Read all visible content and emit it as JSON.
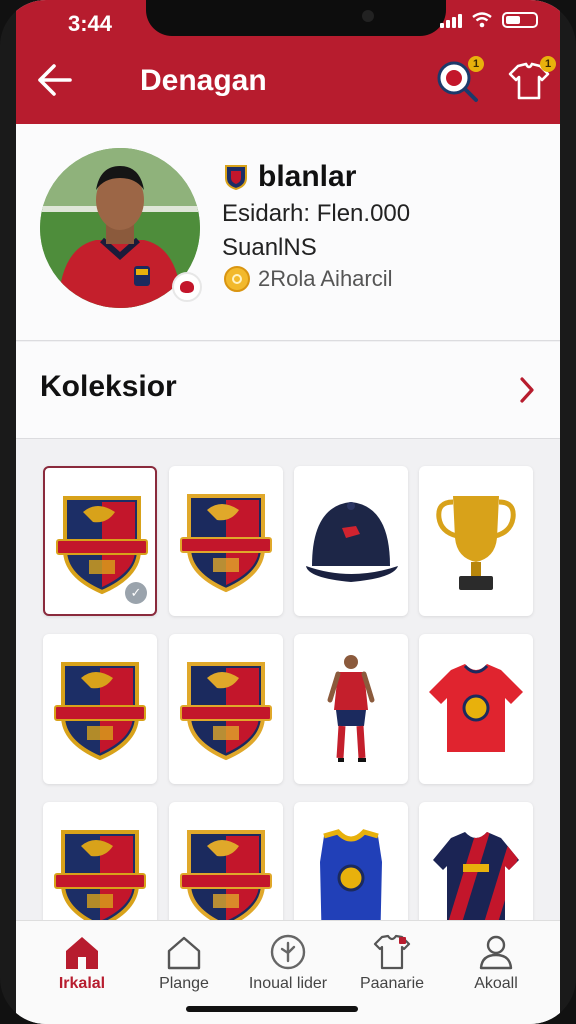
{
  "status_bar": {
    "time": "3:44"
  },
  "header": {
    "title": "Denagan",
    "icons": [
      "back-arrow-icon",
      "magnifier-badge-icon",
      "shirt-badge-icon"
    ],
    "badge_1": "1",
    "badge_2": "1",
    "background": "#b71c2e"
  },
  "profile": {
    "name": "blanlar",
    "line_1": "Esidarh: Flen.000",
    "line_2": "SuanlNS",
    "coins": "2Rola Aiharcil"
  },
  "collection": {
    "title": "Koleksior"
  },
  "grid": {
    "items": [
      {
        "kind": "crest",
        "name": "crest-badge",
        "selected": true
      },
      {
        "kind": "crest",
        "name": "crest-badge"
      },
      {
        "kind": "cap",
        "name": "cap"
      },
      {
        "kind": "trophy",
        "name": "trophy"
      },
      {
        "kind": "crest",
        "name": "crest-badge"
      },
      {
        "kind": "crest",
        "name": "crest-badge"
      },
      {
        "kind": "player",
        "name": "player-figure"
      },
      {
        "kind": "jersey",
        "name": "jersey"
      },
      {
        "kind": "crest",
        "name": "crest-badge"
      },
      {
        "kind": "crest",
        "name": "crest-badge"
      },
      {
        "kind": "jersey-blue",
        "name": "jersey"
      },
      {
        "kind": "jersey-stripe",
        "name": "jersey"
      }
    ]
  },
  "bottom_nav": [
    {
      "label": "Irkalal",
      "icon": "home-icon",
      "active": true
    },
    {
      "label": "Plange",
      "icon": "home-outline-icon"
    },
    {
      "label": "Inoual lider",
      "icon": "compass-icon"
    },
    {
      "label": "Paanarie",
      "icon": "shirt-icon"
    },
    {
      "label": "Akoall",
      "icon": "user-icon"
    }
  ]
}
